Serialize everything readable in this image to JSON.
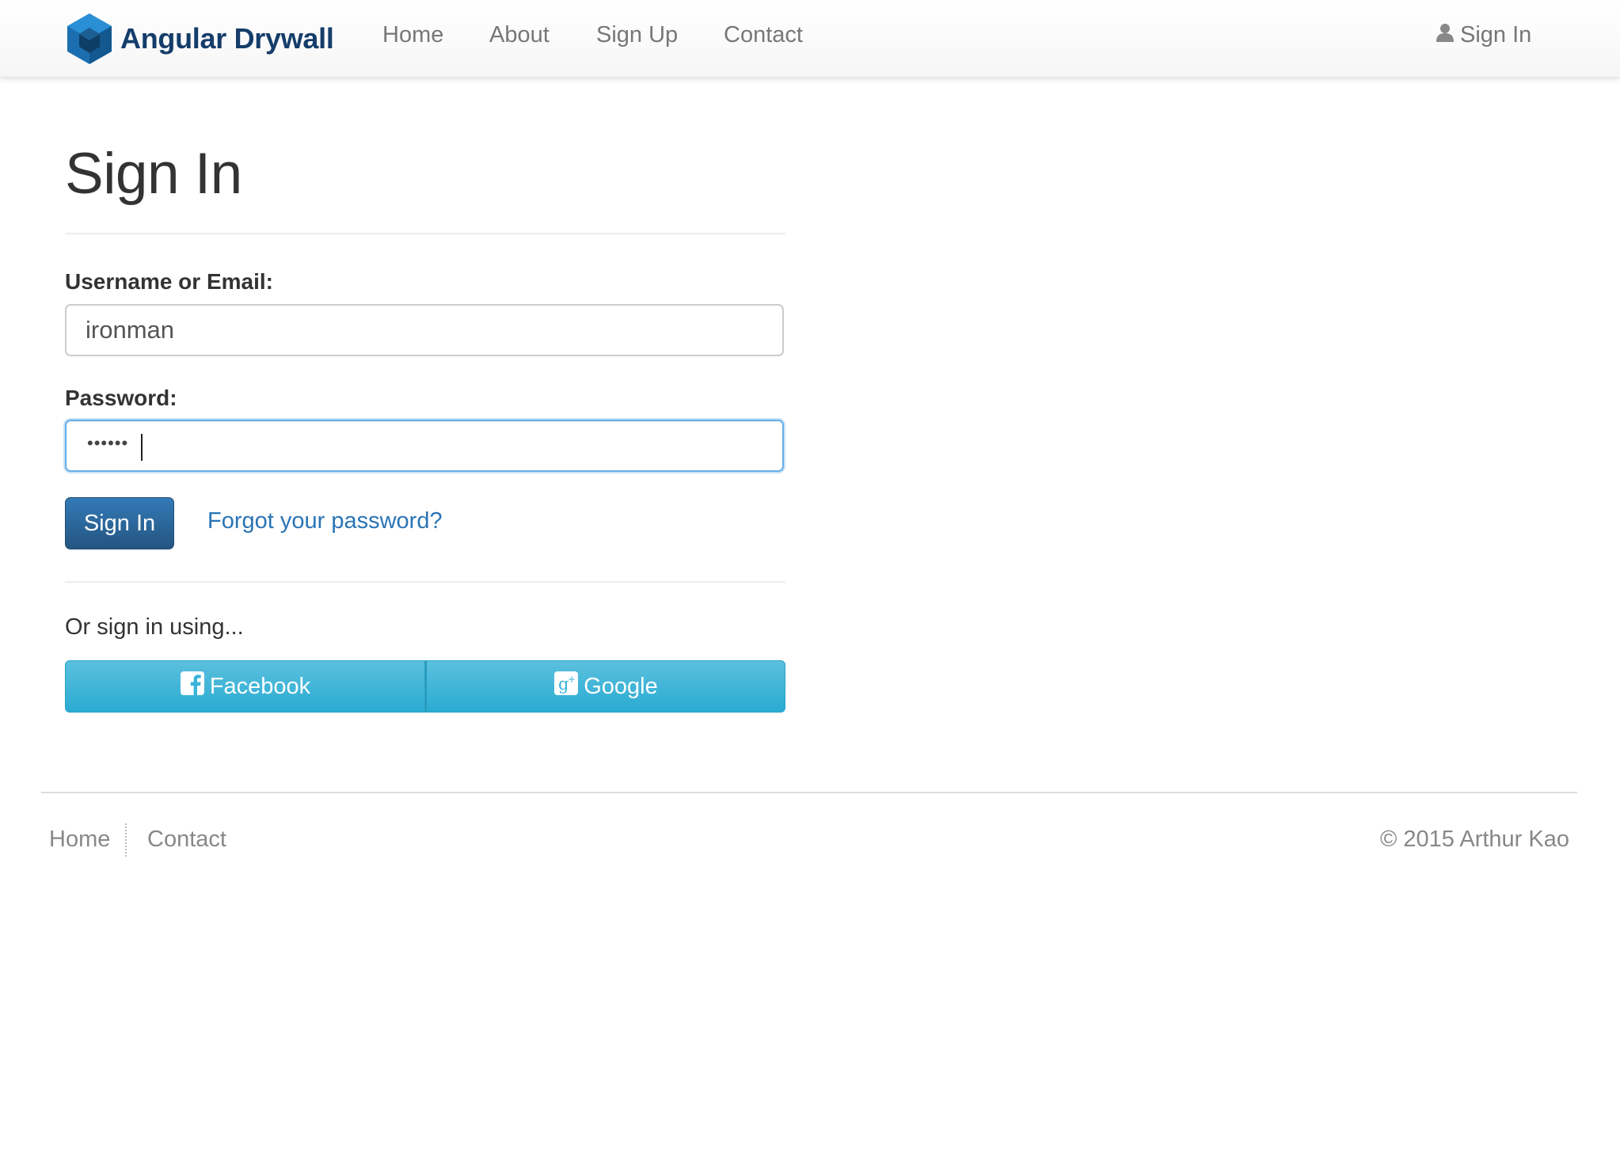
{
  "navbar": {
    "brand": "Angular Drywall",
    "links": [
      "Home",
      "About",
      "Sign Up",
      "Contact"
    ],
    "signin_label": "Sign In"
  },
  "page": {
    "title": "Sign In"
  },
  "form": {
    "username_label": "Username or Email:",
    "username_value": "ironman",
    "password_label": "Password:",
    "password_masked": "••••••",
    "submit_label": "Sign In",
    "forgot_link": "Forgot your password?"
  },
  "social": {
    "intro": "Or sign in using...",
    "facebook_label": "Facebook",
    "google_label": "Google"
  },
  "footer": {
    "links": [
      "Home",
      "Contact"
    ],
    "copyright": "© 2015 Arthur Kao"
  },
  "colors": {
    "brand_text": "#153d6a",
    "primary_button": "#286090",
    "link": "#2a74b5",
    "social_button": "#5bc0de",
    "focus_border": "#66afe9"
  },
  "icons": {
    "brand_logo": "hexagon-cube-logo-icon",
    "signin": "user-icon",
    "facebook": "facebook-icon",
    "google": "google-plus-icon"
  }
}
